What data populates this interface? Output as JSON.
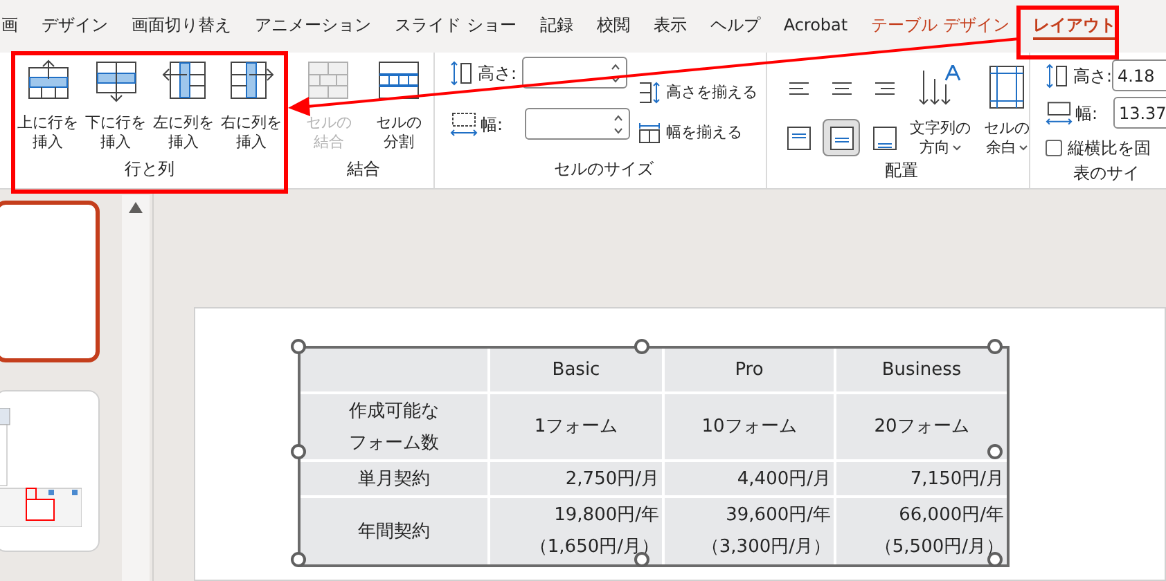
{
  "tabs": [
    {
      "label": "画",
      "selected": false
    },
    {
      "label": "デザイン",
      "selected": false
    },
    {
      "label": "画面切り替え",
      "selected": false
    },
    {
      "label": "アニメーション",
      "selected": false
    },
    {
      "label": "スライド ショー",
      "selected": false
    },
    {
      "label": "記録",
      "selected": false
    },
    {
      "label": "校閲",
      "selected": false
    },
    {
      "label": "表示",
      "selected": false
    },
    {
      "label": "ヘルプ",
      "selected": false
    },
    {
      "label": "Acrobat",
      "selected": false
    },
    {
      "label": "テーブル デザイン",
      "selected": false,
      "kind": "context"
    },
    {
      "label": "レイアウト",
      "selected": true,
      "kind": "context"
    }
  ],
  "ribbon": {
    "groups": [
      {
        "label": "行と列",
        "kind": "buttons",
        "buttons": [
          {
            "lines": [
              "上に行を",
              "挿入"
            ],
            "kind": "row_above",
            "disabled": false
          },
          {
            "lines": [
              "下に行を",
              "挿入"
            ],
            "kind": "row_below",
            "disabled": false
          },
          {
            "lines": [
              "左に列を",
              "挿入"
            ],
            "kind": "col_left",
            "disabled": false
          },
          {
            "lines": [
              "右に列を",
              "挿入"
            ],
            "kind": "col_right",
            "disabled": false
          }
        ]
      },
      {
        "label": "結合",
        "kind": "buttons",
        "buttons": [
          {
            "lines": [
              "セルの",
              "結合"
            ],
            "kind": "merge",
            "disabled": true
          },
          {
            "lines": [
              "セルの",
              "分割"
            ],
            "kind": "split",
            "disabled": false
          }
        ]
      },
      {
        "label": "セルのサイズ",
        "kind": "cell_size",
        "fields": [
          {
            "label": "高さ:",
            "kind": "height"
          },
          {
            "label": "幅:",
            "kind": "width"
          }
        ],
        "actions": [
          {
            "label": "高さを揃える",
            "kind": "height"
          },
          {
            "label": "幅を揃える",
            "kind": "width"
          }
        ]
      },
      {
        "label": "配置",
        "kind": "align",
        "alignment": [
          {
            "kind": "left",
            "selected": false
          },
          {
            "kind": "center",
            "selected": false
          },
          {
            "kind": "right",
            "selected": false
          },
          {
            "kind": "top",
            "selected": false
          },
          {
            "kind": "middle",
            "selected": true
          },
          {
            "kind": "bottom",
            "selected": false
          }
        ],
        "buttons": [
          {
            "lines": [
              "文字列の",
              "方向"
            ],
            "kind": "direction",
            "dropdown": true
          },
          {
            "lines": [
              "セルの",
              "余白"
            ],
            "kind": "margins",
            "dropdown": true
          }
        ]
      },
      {
        "label": "表のサイ",
        "kind": "table_size",
        "fields": [
          {
            "label": "高さ:",
            "value": "4.18",
            "kind": "height"
          },
          {
            "label": "幅:",
            "value": "13.37",
            "kind": "width"
          }
        ],
        "lock_aspect": {
          "label": "縦横比を固",
          "checked": false
        }
      }
    ]
  },
  "slides": [
    {
      "selected": true
    },
    {
      "selected": false
    }
  ],
  "table": {
    "header": [
      "Basic",
      "Pro",
      "Business"
    ],
    "rows": [
      {
        "lines": [
          "作成可能な",
          "フォーム数"
        ],
        "kind": "count",
        "cells": [
          {
            "lines": [
              "1フォーム"
            ]
          },
          {
            "lines": [
              "10フォーム"
            ]
          },
          {
            "lines": [
              "20フォーム"
            ]
          }
        ]
      },
      {
        "lines": [
          "単月契約"
        ],
        "kind": "price",
        "cells": [
          {
            "lines": [
              "2,750円/月"
            ]
          },
          {
            "lines": [
              "4,400円/月"
            ]
          },
          {
            "lines": [
              "7,150円/月"
            ]
          }
        ]
      },
      {
        "lines": [
          "年間契約"
        ],
        "kind": "price",
        "cells": [
          {
            "lines": [
              "19,800円/年",
              "（1,650円/月）"
            ]
          },
          {
            "lines": [
              "39,600円/年",
              "（3,300円/月）"
            ]
          },
          {
            "lines": [
              "66,000円/年",
              "（5,500円/月）"
            ]
          }
        ]
      }
    ]
  }
}
